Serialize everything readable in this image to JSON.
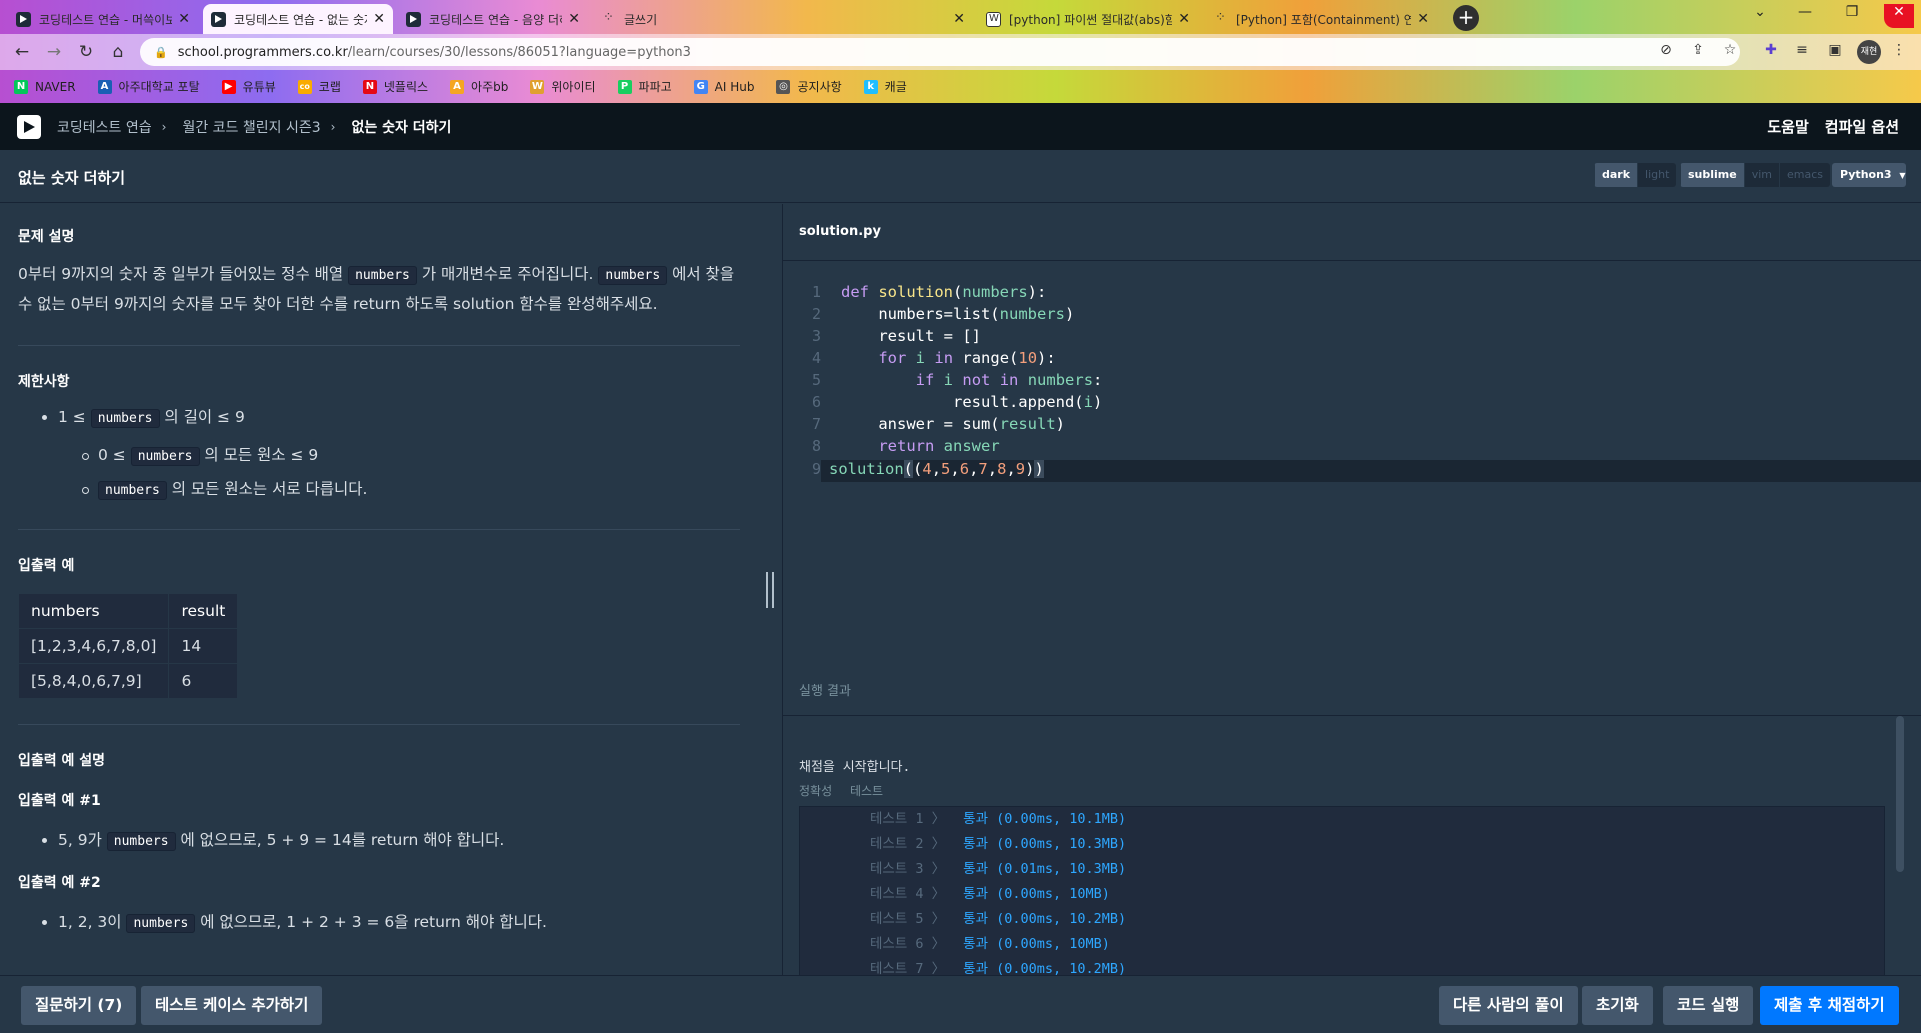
{
  "browser": {
    "tabs": [
      {
        "title": "코딩테스트 연습 - 머쓱이보다 키"
      },
      {
        "title": "코딩테스트 연습 - 없는 숫자 더"
      },
      {
        "title": "코딩테스트 연습 - 음양 더하기 |"
      },
      {
        "title": "글쓰기"
      },
      {
        "title": "[python] 파이썬 절대값(abs)함"
      },
      {
        "title": "[Python] 포함(Containment) 연산"
      }
    ],
    "new_tab": "+",
    "url_host": "school.programmers.co.kr",
    "url_path": "/learn/courses/30/lessons/86051?language=python3",
    "profile": "재현",
    "bookmarks": [
      {
        "label": "NAVER",
        "icon": "N",
        "color": "#03c75a"
      },
      {
        "label": "아주대학교 포탈",
        "icon": "A",
        "color": "#1a5fb4"
      },
      {
        "label": "유튜뷰",
        "icon": "▶",
        "color": "#ff0000"
      },
      {
        "label": "코랩",
        "icon": "co",
        "color": "#f9ab00"
      },
      {
        "label": "넷플릭스",
        "icon": "N",
        "color": "#e50914"
      },
      {
        "label": "아주bb",
        "icon": "A",
        "color": "#f5a623"
      },
      {
        "label": "위아이티",
        "icon": "W",
        "color": "#e0a030"
      },
      {
        "label": "파파고",
        "icon": "P",
        "color": "#19ce60"
      },
      {
        "label": "AI Hub",
        "icon": "G",
        "color": "#4285f4"
      },
      {
        "label": "공지사항",
        "icon": "◎",
        "color": "#555555"
      },
      {
        "label": "캐글",
        "icon": "k",
        "color": "#20beff"
      }
    ]
  },
  "header": {
    "breadcrumb": [
      "코딩테스트 연습",
      "월간 코드 챌린지 시즌3",
      "없는 숫자 더하기"
    ],
    "help": "도움말",
    "compile_options": "컴파일 옵션"
  },
  "titlebar": {
    "title": "없는 숫자 더하기",
    "themes": [
      "dark",
      "light"
    ],
    "keymaps": [
      "sublime",
      "vim",
      "emacs"
    ],
    "language": "Python3"
  },
  "problem": {
    "desc_heading": "문제 설명",
    "desc_part1": "0부터 9까지의 숫자 중 일부가 들어있는 정수 배열 ",
    "desc_code1": "numbers",
    "desc_part2": " 가 매개변수로 주어집니다. ",
    "desc_code2": "numbers",
    "desc_part3": " 에서 찾을 수 없는 0부터 9까지의 숫자를 모두 찾아 더한 수를 return 하도록 solution 함수를 완성해주세요.",
    "limits_heading": "제한사항",
    "limit1_a": "1 ≤ ",
    "limit1_code": "numbers",
    "limit1_b": " 의 길이 ≤ 9",
    "limit2_a": "0 ≤ ",
    "limit2_code": "numbers",
    "limit2_b": " 의 모든 원소 ≤ 9",
    "limit3_code": "numbers",
    "limit3_b": " 의 모든 원소는 서로 다릅니다.",
    "io_heading": "입출력 예",
    "io_table": {
      "headers": [
        "numbers",
        "result"
      ],
      "rows": [
        [
          "[1,2,3,4,6,7,8,0]",
          "14"
        ],
        [
          "[5,8,4,0,6,7,9]",
          "6"
        ]
      ]
    },
    "explain_heading": "입출력 예 설명",
    "ex1_heading": "입출력 예 #1",
    "ex1_a": "5, 9가 ",
    "ex1_code": "numbers",
    "ex1_b": " 에 없으므로, 5 + 9 = 14를 return 해야 합니다.",
    "ex2_heading": "입출력 예 #2",
    "ex2_a": "1, 2, 3이 ",
    "ex2_code": "numbers",
    "ex2_b": " 에 없으므로, 1 + 2 + 3 = 6을 return 해야 합니다."
  },
  "editor": {
    "filename": "solution.py",
    "line_numbers": [
      "1",
      "2",
      "3",
      "4",
      "5",
      "6",
      "7",
      "8",
      "9"
    ]
  },
  "result": {
    "heading": "실행 결과",
    "start_msg": "채점을 시작합니다.",
    "tabs": [
      "정확성",
      "테스트"
    ],
    "tests": [
      {
        "label": "테스트 1 〉",
        "result": "통과 (0.00ms, 10.1MB)"
      },
      {
        "label": "테스트 2 〉",
        "result": "통과 (0.00ms, 10.3MB)"
      },
      {
        "label": "테스트 3 〉",
        "result": "통과 (0.01ms, 10.3MB)"
      },
      {
        "label": "테스트 4 〉",
        "result": "통과 (0.00ms, 10MB)"
      },
      {
        "label": "테스트 5 〉",
        "result": "통과 (0.00ms, 10.2MB)"
      },
      {
        "label": "테스트 6 〉",
        "result": "통과 (0.00ms, 10MB)"
      },
      {
        "label": "테스트 7 〉",
        "result": "통과 (0.00ms, 10.2MB)"
      }
    ]
  },
  "footer": {
    "ask": "질문하기 (7)",
    "add_testcase": "테스트 케이스 추가하기",
    "others": "다른 사람의 풀이",
    "reset": "초기화",
    "run": "코드 실행",
    "submit": "제출 후 채점하기"
  }
}
